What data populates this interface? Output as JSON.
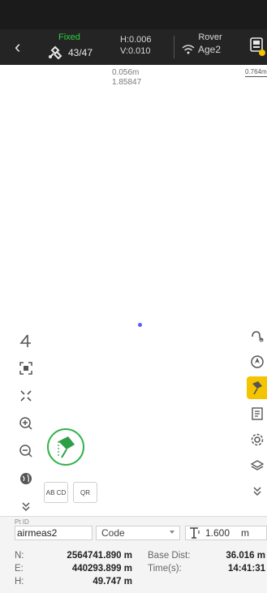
{
  "top_bar": {
    "back_glyph": "‹",
    "fix_status": "Fixed",
    "satellites": "43/47",
    "h_precision": "H:0.006",
    "v_precision": "V:0.010",
    "mode": "Rover",
    "age": "Age2"
  },
  "map": {
    "center_readout_line1": "0.056m",
    "center_readout_line2": "1.85847",
    "scale": "0.764m"
  },
  "left_tools": [
    {
      "name": "orientation-icon",
      "glyph": "4"
    },
    {
      "name": "zoom-fit-icon",
      "glyph": "▣"
    },
    {
      "name": "center-target-icon",
      "glyph": "✕"
    },
    {
      "name": "zoom-in-icon",
      "glyph": "⊕"
    },
    {
      "name": "zoom-out-icon",
      "glyph": "⊖"
    },
    {
      "name": "globe-icon",
      "glyph": "◍"
    },
    {
      "name": "expand-down-icon",
      "glyph": "⌄"
    }
  ],
  "mini_buttons": {
    "all_code": "AB CD",
    "qr": "QR"
  },
  "bottom_panel": {
    "pt_label": "Pt ID",
    "point_name": "airmeas2",
    "code_placeholder": "Code",
    "antenna_height": "1.600",
    "antenna_unit": "m",
    "north_label": "N:",
    "north_value": "2564741.890 m",
    "east_label": "E:",
    "east_value": "440293.899 m",
    "height_label": "H:",
    "height_value": "49.747 m",
    "base_dist_label": "Base Dist:",
    "base_dist_value": "36.016 m",
    "time_label": "Time(s):",
    "time_value": "14:41:31"
  },
  "colors": {
    "fixed_green": "#2ecc40",
    "active_yellow": "#f5c400",
    "position_dot": "#5a5cff"
  }
}
